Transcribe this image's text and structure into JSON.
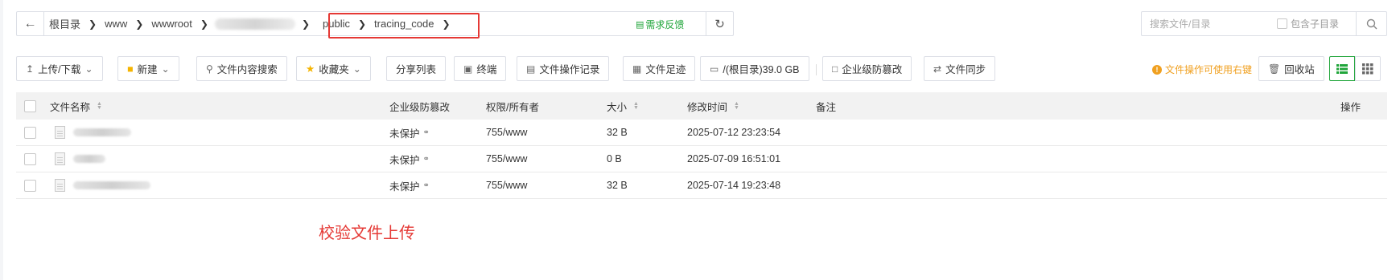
{
  "path": {
    "crumbs": [
      "根目录",
      "www",
      "wwwroot",
      "public",
      "tracing_code"
    ]
  },
  "feedback_label": "需求反馈",
  "search": {
    "placeholder": "搜索文件/目录",
    "include_sub_label": "包含子目录"
  },
  "toolbar": {
    "upload_download": "上传/下载",
    "new": "新建",
    "content_search": "文件内容搜索",
    "favorites": "收藏夹",
    "share_list": "分享列表",
    "terminal": "终端",
    "file_log": "文件操作记录",
    "footprint": "文件足迹",
    "disk": "/(根目录)39.0 GB",
    "tamper_proof": "企业级防篡改",
    "file_sync": "文件同步",
    "right_click_tip": "文件操作可使用右键",
    "recycle_bin": "回收站"
  },
  "table": {
    "headers": {
      "name": "文件名称",
      "tamper": "企业级防篡改",
      "perm": "权限/所有者",
      "size": "大小",
      "mtime": "修改时间",
      "remark": "备注",
      "action": "操作"
    },
    "rows": [
      {
        "tamper": "未保护",
        "perm": "755/www",
        "size": "32 B",
        "mtime": "2025-07-12 23:23:54"
      },
      {
        "tamper": "未保护",
        "perm": "755/www",
        "size": "0 B",
        "mtime": "2025-07-09 16:51:01"
      },
      {
        "tamper": "未保护",
        "perm": "755/www",
        "size": "32 B",
        "mtime": "2025-07-14 19:23:48"
      }
    ]
  },
  "annotation_text": "校验文件上传",
  "colors": {
    "accent_green": "#20a53a",
    "highlight_red": "#e53935",
    "warning_orange": "#f0a020"
  }
}
